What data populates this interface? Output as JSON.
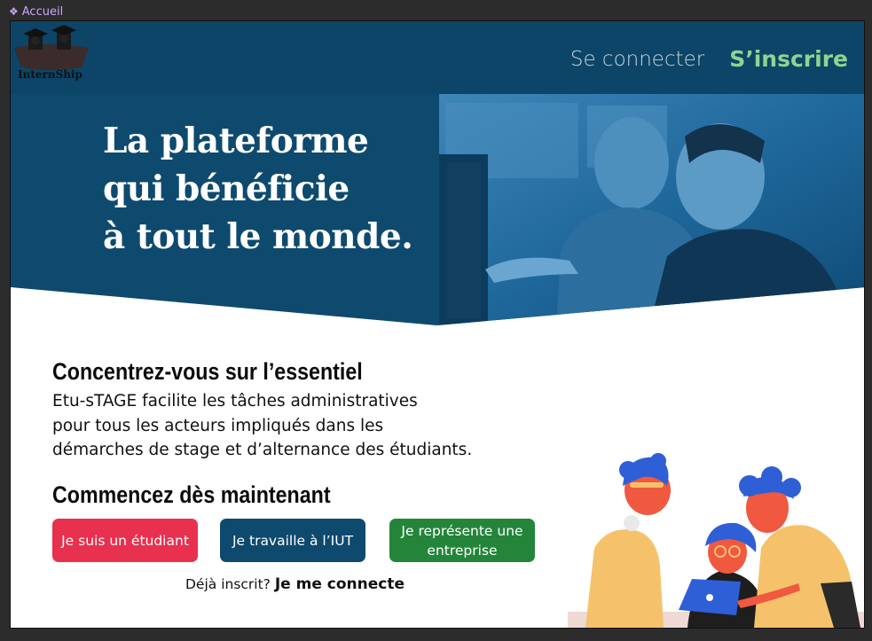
{
  "frame": {
    "label": "Accueil"
  },
  "header": {
    "logo_text": "InternShip",
    "nav": {
      "login": "Se connecter",
      "signup": "S’inscrire"
    }
  },
  "hero": {
    "headline": [
      "La plateforme",
      "qui bénéficie",
      "à tout le monde."
    ]
  },
  "intro": {
    "title": "Concentrez-vous sur l’essentiel",
    "lines": [
      "Etu-sTAGE facilite les tâches administratives",
      "pour tous les acteurs impliqués dans les",
      "démarches de stage et d’alternance des étudiants."
    ]
  },
  "start": {
    "title": "Commencez dès maintenant",
    "buttons": {
      "student": "Je suis un étudiant",
      "iut": "Je travaille à l’IUT",
      "company": "Je représente une entreprise"
    },
    "already_prefix": "Déjà inscrit?",
    "already_link": "Je me connecte"
  },
  "colors": {
    "hero_bg": "#0e4a6e",
    "signup": "#8fd48f",
    "student_btn": "#e8304f",
    "iut_btn": "#0e4a6e",
    "company_btn": "#24853a"
  }
}
